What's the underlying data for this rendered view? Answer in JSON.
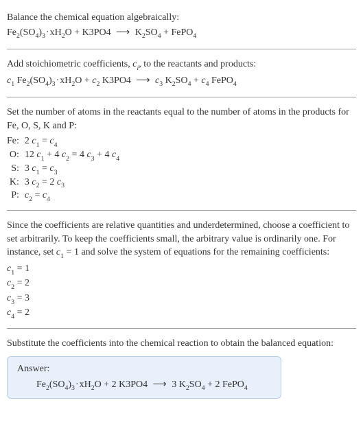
{
  "intro": {
    "line1": "Balance the chemical equation algebraically:",
    "equation": "Fe₂(SO₄)₃·xH₂O + K3PO4 ⟶ K₂SO₄ + FePO₄"
  },
  "step1": {
    "text": "Add stoichiometric coefficients, cᵢ, to the reactants and products:",
    "equation": "c₁ Fe₂(SO₄)₃·xH₂O + c₂ K3PO4 ⟶ c₃ K₂SO₄ + c₄ FePO₄"
  },
  "step2": {
    "text": "Set the number of atoms in the reactants equal to the number of atoms in the products for Fe, O, S, K and P:",
    "rows": [
      {
        "el": "Fe:",
        "eq": "2 c₁ = c₄"
      },
      {
        "el": "O:",
        "eq": "12 c₁ + 4 c₂ = 4 c₃ + 4 c₄"
      },
      {
        "el": "S:",
        "eq": "3 c₁ = c₃"
      },
      {
        "el": "K:",
        "eq": "3 c₂ = 2 c₃"
      },
      {
        "el": "P:",
        "eq": "c₂ = c₄"
      }
    ]
  },
  "step3": {
    "text": "Since the coefficients are relative quantities and underdetermined, choose a coefficient to set arbitrarily. To keep the coefficients small, the arbitrary value is ordinarily one. For instance, set c₁ = 1 and solve the system of equations for the remaining coefficients:",
    "coeffs": [
      "c₁ = 1",
      "c₂ = 2",
      "c₃ = 3",
      "c₄ = 2"
    ]
  },
  "step4": {
    "text": "Substitute the coefficients into the chemical reaction to obtain the balanced equation:"
  },
  "answer": {
    "label": "Answer:",
    "equation": "Fe₂(SO₄)₃·xH₂O + 2 K3PO4 ⟶ 3 K₂SO₄ + 2 FePO₄"
  }
}
